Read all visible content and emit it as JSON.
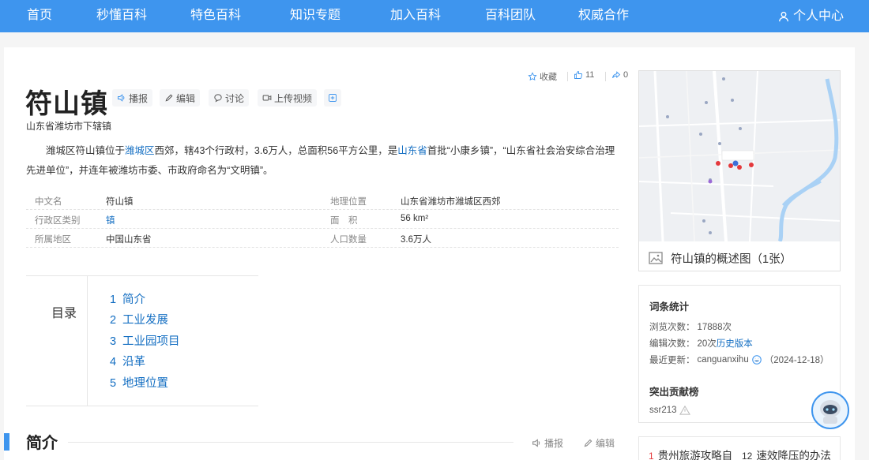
{
  "nav": {
    "items": [
      "首页",
      "秒懂百科",
      "特色百科",
      "知识专题",
      "加入百科",
      "百科团队",
      "权威合作"
    ],
    "user": "个人中心"
  },
  "entry": {
    "title": "符山镇",
    "buttons": {
      "broadcast": "播报",
      "edit": "编辑",
      "discuss": "讨论",
      "upload_video": "上传视频"
    },
    "collect": "收藏",
    "likes": "11",
    "shares": "0",
    "subtitle": "山东省潍坊市下辖镇",
    "summary": {
      "p1": "潍城区符山镇位于",
      "link1": "潍城区",
      "p2": "西郊，辖43个行政村，3.6万人，总面积56平方公里，是",
      "link2": "山东省",
      "p3": "首批“小康乡镇”，“山东省社会治安综合治理先进单位”，并连年被潍坊市委、市政府命名为“文明镇”。"
    }
  },
  "info": [
    {
      "k1": "中文名",
      "v1": "符山镇",
      "k2": "地理位置",
      "v2": "山东省潍坊市潍城区西郊"
    },
    {
      "k1": "行政区类别",
      "v1": "镇",
      "k2": "面　积",
      "v2": "56 km²"
    },
    {
      "k1": "所属地区",
      "v1": "中国山东省",
      "k2": "人口数量",
      "v2": "3.6万人"
    }
  ],
  "toc": {
    "title": "目录",
    "items": [
      {
        "num": "1",
        "label": "简介"
      },
      {
        "num": "2",
        "label": "工业发展"
      },
      {
        "num": "3",
        "label": "工业园项目"
      },
      {
        "num": "4",
        "label": "沿革"
      },
      {
        "num": "5",
        "label": "地理位置"
      }
    ]
  },
  "section": {
    "title": "简介",
    "broadcast": "播报",
    "edit": "编辑"
  },
  "map": {
    "caption": "符山镇的概述图（1张）"
  },
  "stats": {
    "title": "词条统计",
    "views_label": "浏览次数：",
    "views": "17888次",
    "edits_label": "编辑次数：",
    "edits": "20次",
    "history": "历史版本",
    "updated_label": "最近更新：",
    "updated_user": "canguanxihu",
    "updated_date": "（2024-12-18）",
    "contrib_title": "突出贡献榜",
    "contrib_user": "ssr213"
  },
  "hot": [
    {
      "num": "1",
      "label": "贵州旅游攻略自"
    },
    {
      "num": "12",
      "label": "速效降压的办法"
    }
  ],
  "colors": {
    "primary": "#3e95ee",
    "link": "#136ec2",
    "hot": "#e4393c"
  }
}
